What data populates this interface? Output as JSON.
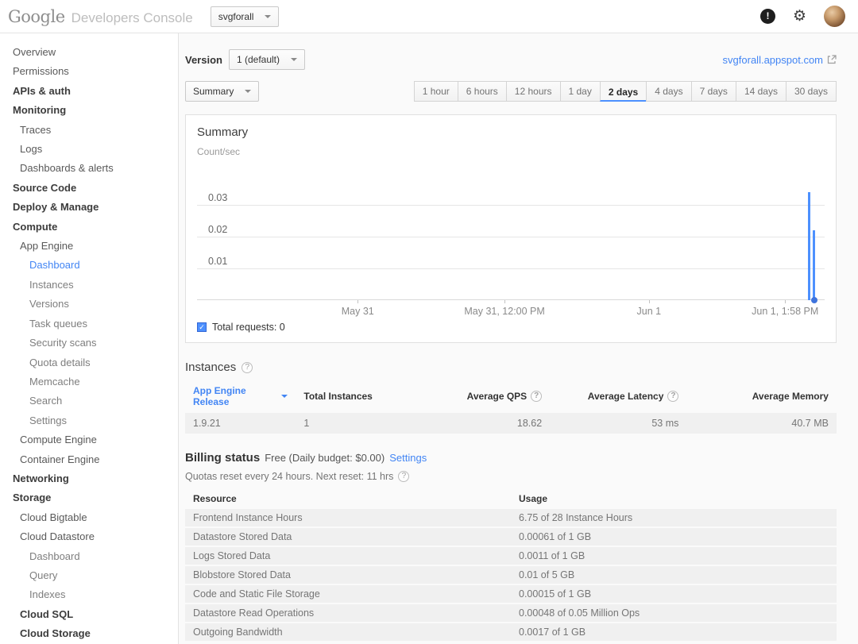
{
  "header": {
    "logo_primary": "Google",
    "logo_secondary": "Developers Console",
    "project_selector": "svgforall",
    "icons": {
      "notification": "exclamation-circle-icon",
      "settings": "gear-icon",
      "avatar": "user-avatar",
      "project_caret": "chevron-down-icon"
    }
  },
  "sidebar": {
    "items": [
      {
        "label": "Overview",
        "indent": 0,
        "style": "normal"
      },
      {
        "label": "Permissions",
        "indent": 0,
        "style": "normal"
      },
      {
        "label": "APIs & auth",
        "indent": 0,
        "style": "bold"
      },
      {
        "label": "Monitoring",
        "indent": 0,
        "style": "bold"
      },
      {
        "label": "Traces",
        "indent": 1,
        "style": "normal"
      },
      {
        "label": "Logs",
        "indent": 1,
        "style": "normal"
      },
      {
        "label": "Dashboards & alerts",
        "indent": 1,
        "style": "normal"
      },
      {
        "label": "Source Code",
        "indent": 0,
        "style": "bold"
      },
      {
        "label": "Deploy & Manage",
        "indent": 0,
        "style": "bold"
      },
      {
        "label": "Compute",
        "indent": 0,
        "style": "bold"
      },
      {
        "label": "App Engine",
        "indent": 1,
        "style": "normal"
      },
      {
        "label": "Dashboard",
        "indent": 2,
        "style": "selected"
      },
      {
        "label": "Instances",
        "indent": 2,
        "style": "muted"
      },
      {
        "label": "Versions",
        "indent": 2,
        "style": "muted"
      },
      {
        "label": "Task queues",
        "indent": 2,
        "style": "muted"
      },
      {
        "label": "Security scans",
        "indent": 2,
        "style": "muted"
      },
      {
        "label": "Quota details",
        "indent": 2,
        "style": "muted"
      },
      {
        "label": "Memcache",
        "indent": 2,
        "style": "muted"
      },
      {
        "label": "Search",
        "indent": 2,
        "style": "muted"
      },
      {
        "label": "Settings",
        "indent": 2,
        "style": "muted"
      },
      {
        "label": "Compute Engine",
        "indent": 1,
        "style": "normal"
      },
      {
        "label": "Container Engine",
        "indent": 1,
        "style": "normal"
      },
      {
        "label": "Networking",
        "indent": 0,
        "style": "bold"
      },
      {
        "label": "Storage",
        "indent": 0,
        "style": "bold"
      },
      {
        "label": "Cloud Bigtable",
        "indent": 1,
        "style": "normal"
      },
      {
        "label": "Cloud Datastore",
        "indent": 1,
        "style": "normal"
      },
      {
        "label": "Dashboard",
        "indent": 2,
        "style": "muted"
      },
      {
        "label": "Query",
        "indent": 2,
        "style": "muted"
      },
      {
        "label": "Indexes",
        "indent": 2,
        "style": "muted"
      },
      {
        "label": "Cloud SQL",
        "indent": 1,
        "style": "bold"
      },
      {
        "label": "Cloud Storage",
        "indent": 1,
        "style": "bold"
      }
    ]
  },
  "toolbar": {
    "version_label": "Version",
    "version_value": "1 (default)",
    "app_link": "svgforall.appspot.com",
    "metric_selector": "Summary",
    "time_ranges": [
      "1 hour",
      "6 hours",
      "12 hours",
      "1 day",
      "2 days",
      "4 days",
      "7 days",
      "14 days",
      "30 days"
    ],
    "selected_range": "2 days"
  },
  "chart_data": {
    "type": "line",
    "title": "Summary",
    "ylabel": "Count/sec",
    "ylim": [
      0,
      0.04
    ],
    "yticks": [
      "0.03",
      "0.02",
      "0.01"
    ],
    "xticks": [
      {
        "label": "May 31",
        "pos": 0.256
      },
      {
        "label": "May 31, 12:00 PM",
        "pos": 0.49
      },
      {
        "label": "Jun 1",
        "pos": 0.72
      },
      {
        "label": "Jun 1, 1:58 PM",
        "pos": 0.937
      }
    ],
    "series": [
      {
        "name": "Total requests",
        "color": "#4d90fe",
        "spikes": [
          {
            "pos": 0.973,
            "value": 0.034
          },
          {
            "pos": 0.981,
            "value": 0.022
          }
        ],
        "end_dot_pos": 0.983,
        "current_value": 0
      }
    ],
    "legend": [
      "Total requests: 0"
    ],
    "legend_color": "#4d90fe",
    "grid": true,
    "legend_position": "bottom-left"
  },
  "instances": {
    "title": "Instances",
    "columns": [
      {
        "label": "App Engine Release",
        "align": "left",
        "link": true,
        "help": false
      },
      {
        "label": "Total Instances",
        "align": "left",
        "link": false,
        "help": false
      },
      {
        "label": "Average QPS",
        "align": "right",
        "link": false,
        "help": true
      },
      {
        "label": "Average Latency",
        "align": "right",
        "link": false,
        "help": true
      },
      {
        "label": "Average Memory",
        "align": "right",
        "link": false,
        "help": false
      }
    ],
    "rows": [
      [
        "1.9.21",
        "1",
        "18.62",
        "53 ms",
        "40.7 MB"
      ]
    ]
  },
  "billing": {
    "title": "Billing status",
    "status_text": "Free (Daily budget: $0.00)",
    "settings_link": "Settings",
    "quota_text": "Quotas reset every 24 hours. Next reset: 11 hrs"
  },
  "resources": {
    "columns": [
      "Resource",
      "Usage"
    ],
    "rows": [
      [
        "Frontend Instance Hours",
        "6.75 of 28 Instance Hours"
      ],
      [
        "Datastore Stored Data",
        "0.00061 of 1 GB"
      ],
      [
        "Logs Stored Data",
        "0.0011 of 1 GB"
      ],
      [
        "Blobstore Stored Data",
        "0.01 of 5 GB"
      ],
      [
        "Code and Static File Storage",
        "0.00015 of 1 GB"
      ],
      [
        "Datastore Read Operations",
        "0.00048 of 0.05 Million Ops"
      ],
      [
        "Outgoing Bandwidth",
        "0.0017 of 1 GB"
      ]
    ]
  }
}
